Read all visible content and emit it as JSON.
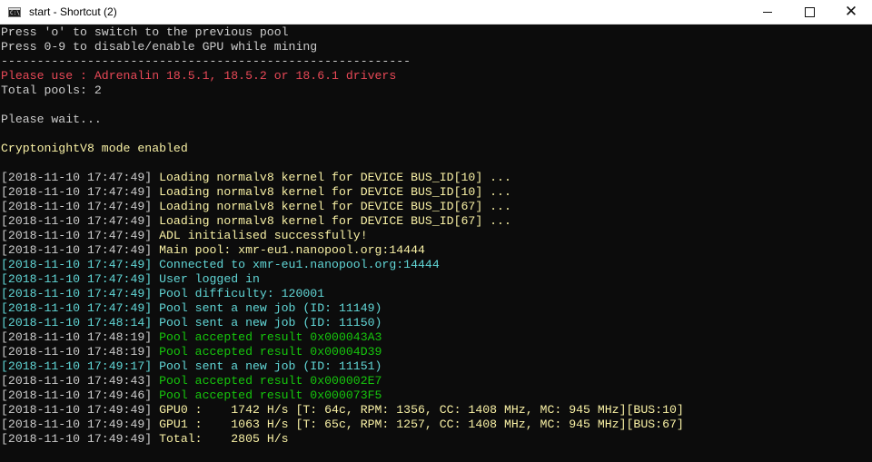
{
  "window": {
    "title": "start - Shortcut (2)",
    "icon_label": "C:\\",
    "minimize_icon": "minimize-icon",
    "maximize_icon": "maximize-icon",
    "close_icon": "close-icon"
  },
  "colors": {
    "background": "#0c0c0c",
    "default_text": "#cccccc",
    "warning_red": "#e74856",
    "info_yellow": "#f9f1a5",
    "pool_cyan": "#61d6d6",
    "accepted_green": "#16c60c"
  },
  "console": {
    "lines": [
      {
        "ts": "",
        "text": "Press 'o' to switch to the previous pool",
        "color": "white"
      },
      {
        "ts": "",
        "text": "Press 0-9 to disable/enable GPU while mining",
        "color": "white"
      },
      {
        "ts": "",
        "text": "---------------------------------------------------------",
        "color": "white"
      },
      {
        "ts": "",
        "text": "Please use : Adrenalin 18.5.1, 18.5.2 or 18.6.1 drivers",
        "color": "red"
      },
      {
        "ts": "",
        "text": "Total pools: 2",
        "color": "white"
      },
      {
        "ts": "",
        "text": "",
        "color": "white"
      },
      {
        "ts": "",
        "text": "Please wait...",
        "color": "white"
      },
      {
        "ts": "",
        "text": "",
        "color": "white"
      },
      {
        "ts": "",
        "text": "CryptonightV8 mode enabled",
        "color": "yellow"
      },
      {
        "ts": "",
        "text": "",
        "color": "white"
      },
      {
        "ts": "[2018-11-10 17:47:49] ",
        "text": "Loading normalv8 kernel for DEVICE BUS_ID[10] ...",
        "color": "yellow"
      },
      {
        "ts": "[2018-11-10 17:47:49] ",
        "text": "Loading normalv8 kernel for DEVICE BUS_ID[10] ...",
        "color": "yellow"
      },
      {
        "ts": "[2018-11-10 17:47:49] ",
        "text": "Loading normalv8 kernel for DEVICE BUS_ID[67] ...",
        "color": "yellow"
      },
      {
        "ts": "[2018-11-10 17:47:49] ",
        "text": "Loading normalv8 kernel for DEVICE BUS_ID[67] ...",
        "color": "yellow"
      },
      {
        "ts": "[2018-11-10 17:47:49] ",
        "text": "ADL initialised successfully!",
        "color": "yellow"
      },
      {
        "ts": "[2018-11-10 17:47:49] ",
        "text": "Main pool: xmr-eu1.nanopool.org:14444",
        "color": "yellow"
      },
      {
        "ts": "[2018-11-10 17:47:49] ",
        "text": "Connected to xmr-eu1.nanopool.org:14444",
        "color": "cyan",
        "ts_color": "cyan"
      },
      {
        "ts": "[2018-11-10 17:47:49] ",
        "text": "User logged in",
        "color": "cyan",
        "ts_color": "cyan"
      },
      {
        "ts": "[2018-11-10 17:47:49] ",
        "text": "Pool difficulty: 120001",
        "color": "cyan",
        "ts_color": "cyan"
      },
      {
        "ts": "[2018-11-10 17:47:49] ",
        "text": "Pool sent a new job (ID: 11149)",
        "color": "cyan",
        "ts_color": "cyan"
      },
      {
        "ts": "[2018-11-10 17:48:14] ",
        "text": "Pool sent a new job (ID: 11150)",
        "color": "cyan",
        "ts_color": "cyan"
      },
      {
        "ts": "[2018-11-10 17:48:19] ",
        "text": "Pool accepted result 0x000043A3",
        "color": "green"
      },
      {
        "ts": "[2018-11-10 17:48:19] ",
        "text": "Pool accepted result 0x00004D39",
        "color": "green"
      },
      {
        "ts": "[2018-11-10 17:49:17] ",
        "text": "Pool sent a new job (ID: 11151)",
        "color": "cyan",
        "ts_color": "cyan"
      },
      {
        "ts": "[2018-11-10 17:49:43] ",
        "text": "Pool accepted result 0x000002E7",
        "color": "green"
      },
      {
        "ts": "[2018-11-10 17:49:46] ",
        "text": "Pool accepted result 0x000073F5",
        "color": "green"
      },
      {
        "ts": "[2018-11-10 17:49:49] ",
        "text": "GPU0 :    1742 H/s [T: 64c, RPM: 1356, CC: 1408 MHz, MC: 945 MHz][BUS:10]",
        "color": "yellow"
      },
      {
        "ts": "[2018-11-10 17:49:49] ",
        "text": "GPU1 :    1063 H/s [T: 65c, RPM: 1257, CC: 1408 MHz, MC: 945 MHz][BUS:67]",
        "color": "yellow"
      },
      {
        "ts": "[2018-11-10 17:49:49] ",
        "text": "Total:    2805 H/s",
        "color": "yellow"
      }
    ]
  }
}
